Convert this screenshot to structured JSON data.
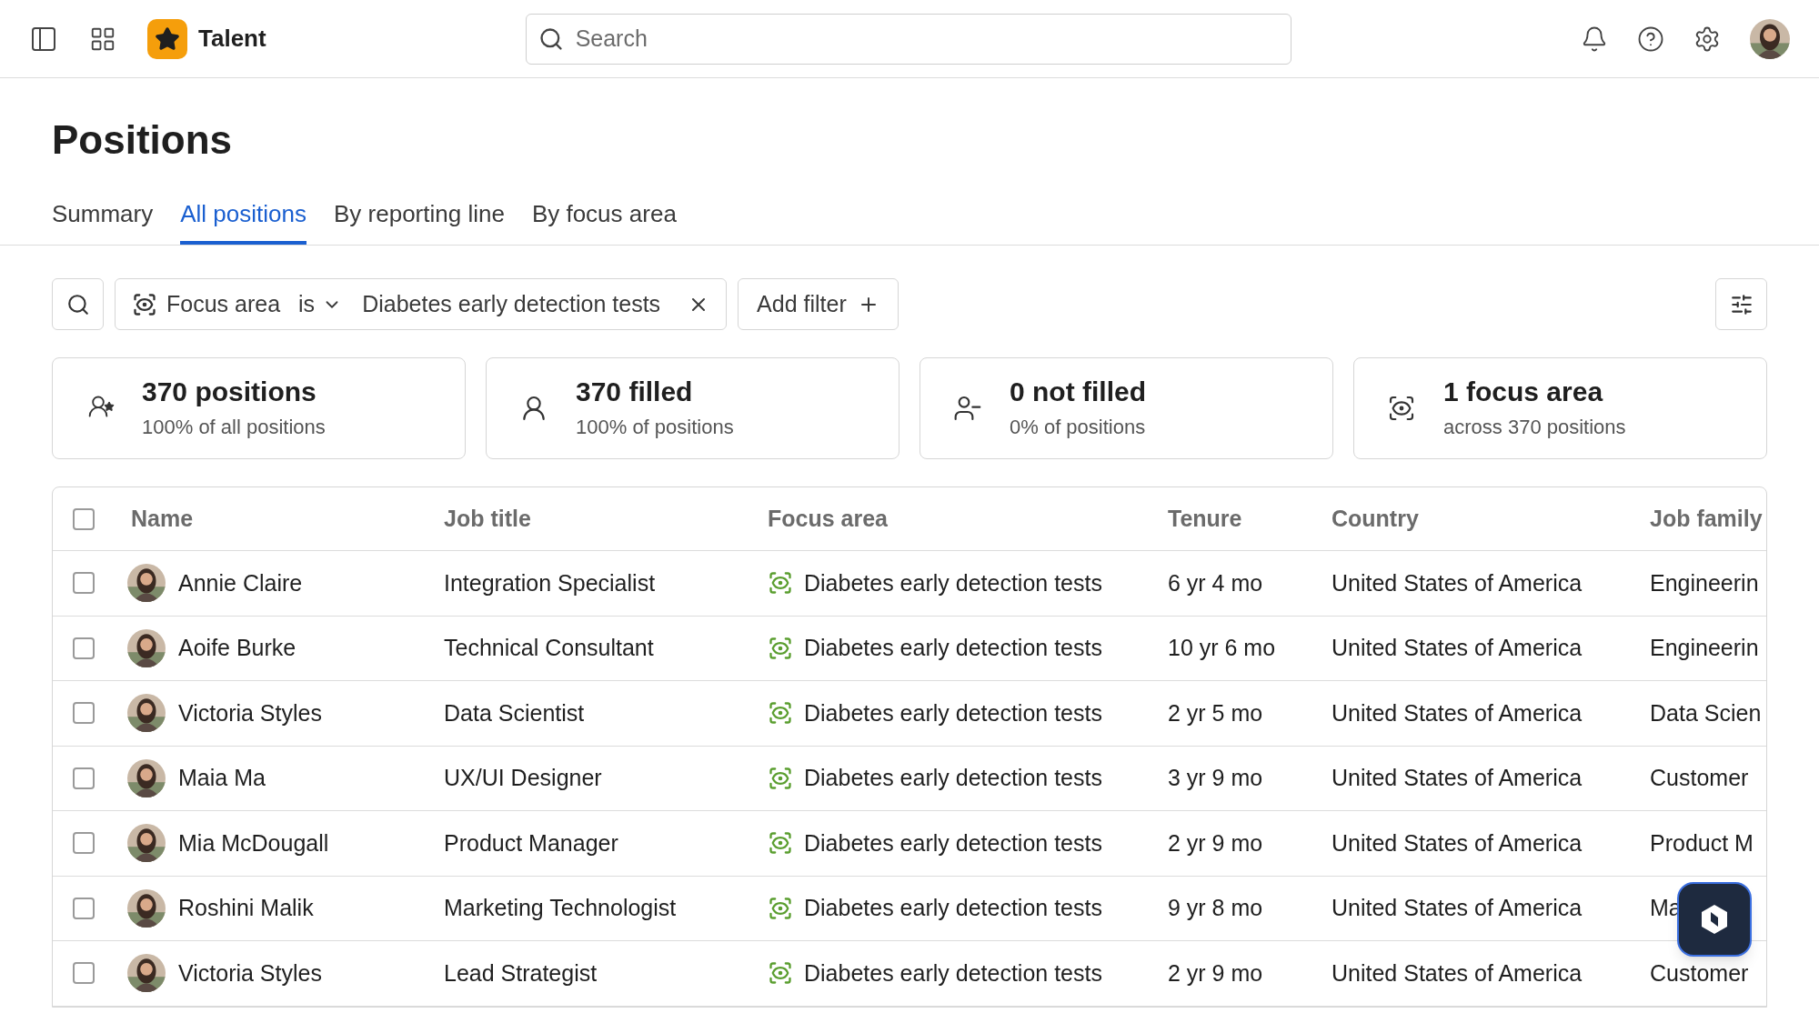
{
  "app": {
    "name": "Talent"
  },
  "search": {
    "placeholder": "Search"
  },
  "page_title": "Positions",
  "tabs": [
    {
      "label": "Summary",
      "selected": false
    },
    {
      "label": "All positions",
      "selected": true
    },
    {
      "label": "By reporting line",
      "selected": false
    },
    {
      "label": "By focus area",
      "selected": false
    }
  ],
  "filter": {
    "field": "Focus area",
    "operator": "is",
    "value": "Diabetes early detection tests"
  },
  "add_filter": "Add filter",
  "stats": [
    {
      "kind": "positions",
      "title": "370 positions",
      "subtitle": "100% of all positions"
    },
    {
      "kind": "filled",
      "title": "370 filled",
      "subtitle": "100% of positions"
    },
    {
      "kind": "not_filled",
      "title": "0 not filled",
      "subtitle": "0% of positions"
    },
    {
      "kind": "focus",
      "title": "1 focus area",
      "subtitle": "across 370 positions"
    }
  ],
  "table": {
    "select_all_checked": false,
    "columns": [
      "Name",
      "Job title",
      "Focus area",
      "Tenure",
      "Country",
      "Job family"
    ],
    "rows": [
      {
        "checked": false,
        "name": "Annie Claire",
        "job_title": "Integration Specialist",
        "focus_area": "Diabetes early detection tests",
        "tenure": "6 yr 4 mo",
        "country": "United States of America",
        "job_family": "Engineerin"
      },
      {
        "checked": false,
        "name": "Aoife Burke",
        "job_title": "Technical Consultant",
        "focus_area": "Diabetes early detection tests",
        "tenure": "10 yr 6 mo",
        "country": "United States of America",
        "job_family": "Engineerin"
      },
      {
        "checked": false,
        "name": "Victoria Styles",
        "job_title": "Data Scientist",
        "focus_area": "Diabetes early detection tests",
        "tenure": "2 yr 5 mo",
        "country": "United States of America",
        "job_family": "Data Scien"
      },
      {
        "checked": false,
        "name": "Maia Ma",
        "job_title": "UX/UI Designer",
        "focus_area": "Diabetes early detection tests",
        "tenure": "3 yr 9 mo",
        "country": "United States of America",
        "job_family": "Customer"
      },
      {
        "checked": false,
        "name": "Mia McDougall",
        "job_title": "Product Manager",
        "focus_area": "Diabetes early detection tests",
        "tenure": "2 yr 9 mo",
        "country": "United States of America",
        "job_family": "Product M"
      },
      {
        "checked": false,
        "name": "Roshini Malik",
        "job_title": "Marketing Technologist",
        "focus_area": "Diabetes early detection tests",
        "tenure": "9 yr 8 mo",
        "country": "United States of America",
        "job_family": "Ma"
      },
      {
        "checked": false,
        "name": "Victoria Styles",
        "job_title": "Lead Strategist",
        "focus_area": "Diabetes early detection tests",
        "tenure": "2 yr 9 mo",
        "country": "United States of America",
        "job_family": "Customer"
      }
    ]
  }
}
